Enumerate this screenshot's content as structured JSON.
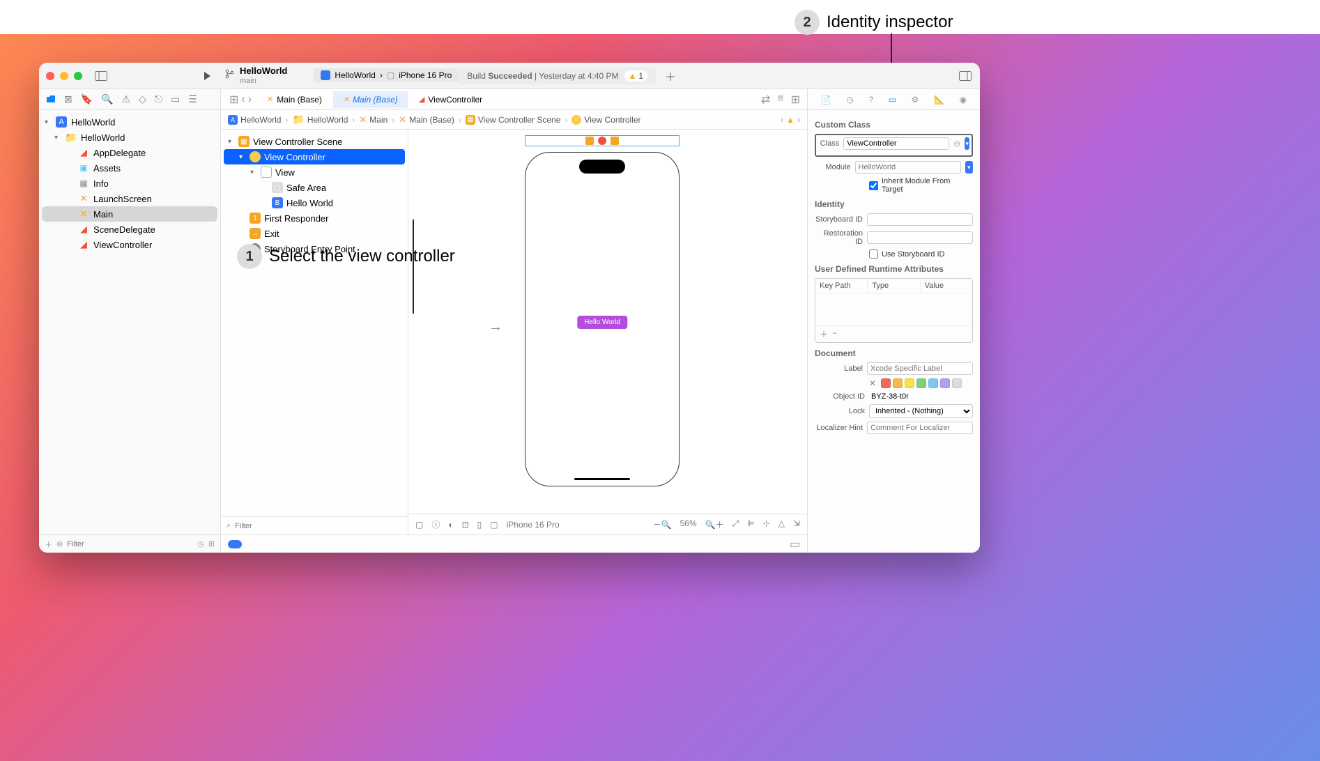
{
  "annotations": {
    "one": "Select the view controller",
    "two": "Identity inspector"
  },
  "toolbar": {
    "project": "HelloWorld",
    "branch": "main",
    "scheme": "HelloWorld",
    "device": "iPhone 16 Pro",
    "status_prefix": "Build ",
    "status_strong": "Succeeded",
    "status_suffix": " | Yesterday at 4:40 PM",
    "warning_count": "1"
  },
  "navigator": {
    "root": "HelloWorld",
    "group": "HelloWorld",
    "files": [
      "AppDelegate",
      "Assets",
      "Info",
      "LaunchScreen",
      "Main",
      "SceneDelegate",
      "ViewController"
    ],
    "filter_placeholder": "Filter"
  },
  "tabs": {
    "t1": "Main (Base)",
    "t2": "Main (Base)",
    "t3": "ViewController"
  },
  "crumbs": [
    "HelloWorld",
    "HelloWorld",
    "Main",
    "Main (Base)",
    "View Controller Scene",
    "View Controller"
  ],
  "outline": {
    "scene": "View Controller Scene",
    "vc": "View Controller",
    "view": "View",
    "safe": "Safe Area",
    "button": "Hello World",
    "first_responder": "First Responder",
    "exit": "Exit",
    "entry": "Storyboard Entry Point",
    "filter_placeholder": "Filter"
  },
  "canvas": {
    "button_label": "Hello World",
    "device": "iPhone 16 Pro",
    "zoom": "56%"
  },
  "inspector": {
    "sections": {
      "custom_class": "Custom Class",
      "identity": "Identity",
      "runtime": "User Defined Runtime Attributes",
      "document": "Document"
    },
    "class_label": "Class",
    "class_value": "ViewController",
    "module_label": "Module",
    "module_placeholder": "HelloWorld",
    "inherit_label": "Inherit Module From Target",
    "storyboard_id_label": "Storyboard ID",
    "restoration_id_label": "Restoration ID",
    "use_sb_label": "Use Storyboard ID",
    "runtime_cols": [
      "Key Path",
      "Type",
      "Value"
    ],
    "doc_label_label": "Label",
    "doc_label_placeholder": "Xcode Specific Label",
    "object_id_label": "Object ID",
    "object_id_value": "BYZ-38-t0r",
    "lock_label": "Lock",
    "lock_value": "Inherited - (Nothing)",
    "localizer_label": "Localizer Hint",
    "localizer_placeholder": "Comment For Localizer",
    "swatches": [
      "#ec6b5e",
      "#f3ba4b",
      "#f3e24b",
      "#7ed07e",
      "#7ec7f3",
      "#b99cf0",
      "#dcdcdc"
    ]
  }
}
